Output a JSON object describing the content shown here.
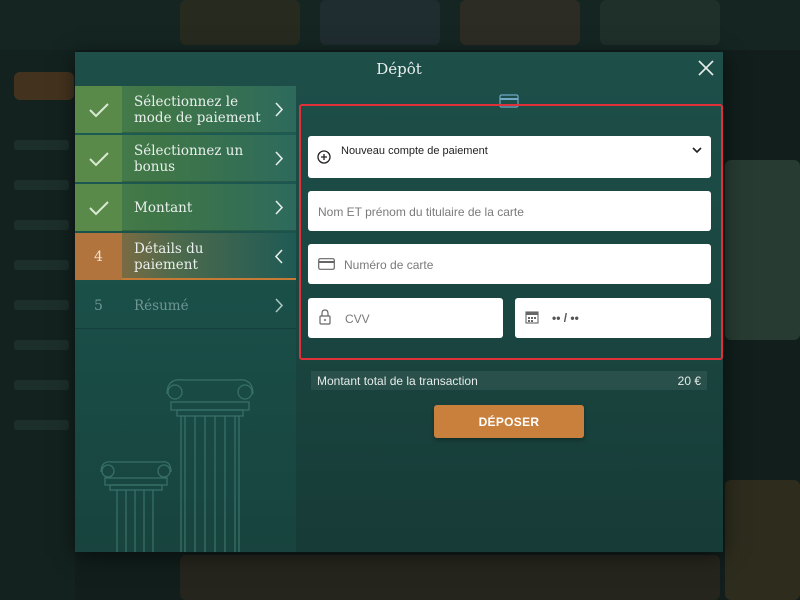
{
  "modal": {
    "title": "Dépôt"
  },
  "steps": [
    {
      "indicator": "",
      "label": "Sélectionnez le mode de paiement",
      "state": "done"
    },
    {
      "indicator": "",
      "label": "Sélectionnez un bonus",
      "state": "done"
    },
    {
      "indicator": "",
      "label": "Montant",
      "state": "done"
    },
    {
      "indicator": "4",
      "label": "Détails du paiement",
      "state": "active"
    },
    {
      "indicator": "5",
      "label": "Résumé",
      "state": "pending"
    }
  ],
  "form": {
    "payment_account_label": "Nouveau compte de paiement",
    "cardholder_placeholder": "Nom ET prénom du titulaire de la carte",
    "card_number_placeholder": "Numéro de carte",
    "cvv_placeholder": "CVV",
    "expiry_placeholder": "•• / ••"
  },
  "total": {
    "label": "Montant total de la transaction",
    "amount": "20 €"
  },
  "deposit_button": "DÉPOSER",
  "colors": {
    "accent": "#c9803c",
    "done_step": "#4a7d4a",
    "highlight_border": "#e0313a",
    "modal_bg": "#1a4540"
  },
  "icons": [
    "close-icon",
    "check-icon",
    "chevron-right-icon",
    "chevron-left-icon",
    "plus-circle-icon",
    "chevron-down-icon",
    "credit-card-icon",
    "lock-icon",
    "calendar-icon",
    "pillars-decoration"
  ]
}
